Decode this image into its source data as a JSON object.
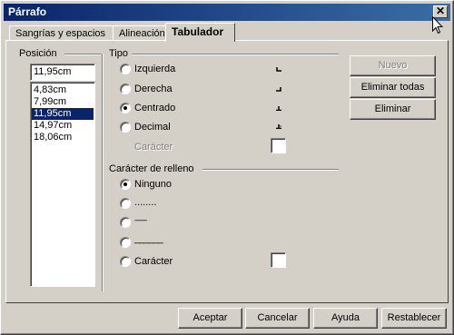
{
  "window": {
    "title": "Párrafo",
    "close_symbol": "✕"
  },
  "tabs": [
    {
      "label": "Sangrías y espacios",
      "active": false
    },
    {
      "label": "Alineación",
      "active": false
    },
    {
      "label": "Tabulador",
      "active": true
    }
  ],
  "position": {
    "label": "Posición",
    "value": "11,95cm",
    "items": [
      "4,83cm",
      "7,99cm",
      "11,95cm",
      "14,97cm",
      "18,06cm"
    ],
    "selected": "11,95cm"
  },
  "tipo": {
    "label": "Tipo",
    "options": [
      {
        "label": "Izquierda",
        "checked": false,
        "icon": "tab-left-icon"
      },
      {
        "label": "Derecha",
        "checked": false,
        "icon": "tab-right-icon"
      },
      {
        "label": "Centrado",
        "checked": true,
        "icon": "tab-center-icon"
      },
      {
        "label": "Decimal",
        "checked": false,
        "icon": "tab-decimal-icon"
      }
    ],
    "caracter_label": "Carácter"
  },
  "relleno": {
    "label": "Carácter de relleno",
    "options": [
      {
        "label": "Ninguno",
        "checked": true
      },
      {
        "label": "........",
        "checked": false
      },
      {
        "label": "--------",
        "checked": false
      },
      {
        "label": "______",
        "checked": false
      },
      {
        "label": "Carácter",
        "checked": false
      }
    ]
  },
  "side_buttons": {
    "nuevo": "Nuevo",
    "eliminar_todas": "Eliminar todas",
    "eliminar": "Eliminar"
  },
  "footer_buttons": {
    "aceptar": "Aceptar",
    "cancelar": "Cancelar",
    "ayuda": "Ayuda",
    "restablecer": "Restablecer"
  },
  "colors": {
    "titlebar_start": "#0a246a",
    "titlebar_end": "#3a6ea5",
    "face": "#d4d0c8",
    "selection": "#0a246a"
  }
}
